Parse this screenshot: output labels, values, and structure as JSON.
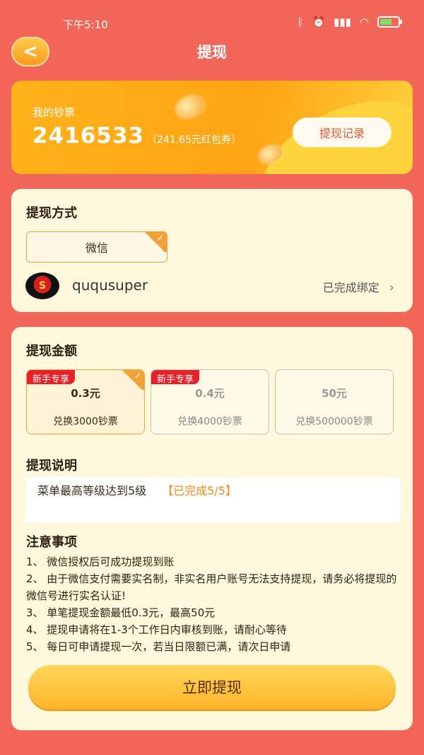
{
  "status_bar": {
    "time": "下午5:10",
    "icons": [
      "bluetooth-icon",
      "alarm-icon",
      "signal-icon",
      "wifi-icon",
      "battery-icon"
    ]
  },
  "header": {
    "title": "提现",
    "back_label": "<"
  },
  "banner": {
    "label": "我的钞票",
    "amount": "2416533",
    "amount_note": "（241.65元红包券）",
    "record_button": "提现记录"
  },
  "method": {
    "title": "提现方式",
    "option": "微信",
    "check": "✓",
    "username": "ququsuper",
    "bind_status": "已完成绑定",
    "chevron": "›"
  },
  "amount": {
    "title": "提现金额",
    "options": [
      {
        "badge": "新手专享",
        "value": "0.3元",
        "sub": "兑换3000钞票"
      },
      {
        "badge": "新手专享",
        "value": "0.4元",
        "sub": "兑换4000钞票"
      },
      {
        "badge": "",
        "value": "50元",
        "sub": "兑换500000钞票"
      }
    ],
    "selected_index": 0
  },
  "description": {
    "title": "提现说明",
    "text": "菜单最高等级达到5级",
    "status": "【已完成5/5】"
  },
  "notes": {
    "title": "注意事项",
    "items": [
      "1、 微信授权后可成功提现到账",
      "2、 由于微信支付需要实名制，非实名用户账号无法支持提现，请务必将提现的微信号进行实名认证!",
      "3、 单笔提现金额最低0.3元，最高50元",
      "4、 提现申请将在1-3个工作日内审核到账，请耐心等待",
      "5、 每日可申请提现一次，若当日限额已满，请次日申请"
    ]
  },
  "submit_button": "立即提现",
  "colors": {
    "background": "#F2665A",
    "accent": "#F0A236",
    "card": "#FFF8DC",
    "badge": "#E8202A"
  }
}
